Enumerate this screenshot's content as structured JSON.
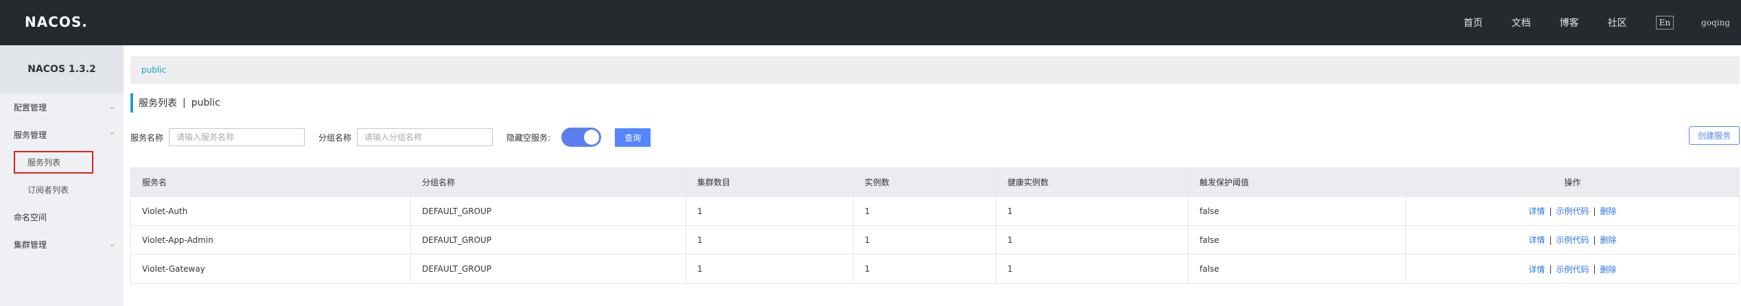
{
  "header": {
    "logo": "NACOS.",
    "nav": [
      "首页",
      "文档",
      "博客",
      "社区"
    ],
    "lang": "En",
    "user": "goqing"
  },
  "sidebar": {
    "title": "NACOS 1.3.2",
    "items": [
      {
        "label": "配置管理",
        "icon": "chevron-down-icon"
      },
      {
        "label": "服务管理",
        "icon": "chevron-up-icon"
      },
      {
        "label": "服务列表",
        "active": true
      },
      {
        "label": "订阅者列表"
      },
      {
        "label": "命名空间"
      },
      {
        "label": "集群管理",
        "icon": "chevron-down-icon"
      }
    ]
  },
  "breadcrumb": "public",
  "page_title": {
    "main": "服务列表",
    "sep": "|",
    "namespace": "public"
  },
  "filters": {
    "service_label": "服务名称",
    "service_placeholder": "请输入服务名称",
    "group_label": "分组名称",
    "group_placeholder": "请输入分组名称",
    "hide_empty_label": "隐藏空服务:",
    "hide_empty_on": true,
    "query_button": "查询",
    "create_button": "创建服务"
  },
  "table": {
    "columns": [
      "服务名",
      "分组名称",
      "集群数目",
      "实例数",
      "健康实例数",
      "触发保护阈值",
      "操作"
    ],
    "rows": [
      {
        "name": "Violet-Auth",
        "group": "DEFAULT_GROUP",
        "clusters": "1",
        "instances": "1",
        "healthy": "1",
        "threshold": "false"
      },
      {
        "name": "Violet-App-Admin",
        "group": "DEFAULT_GROUP",
        "clusters": "1",
        "instances": "1",
        "healthy": "1",
        "threshold": "false"
      },
      {
        "name": "Violet-Gateway",
        "group": "DEFAULT_GROUP",
        "clusters": "1",
        "instances": "1",
        "healthy": "1",
        "threshold": "false"
      }
    ],
    "actions": {
      "detail": "详情",
      "sample": "示例代码",
      "delete": "删除",
      "sep": "|"
    }
  },
  "colors": {
    "header_bg": "#252a2f",
    "accent": "#5584ff",
    "link": "#2b73e6",
    "highlight": "#e01e1e"
  }
}
